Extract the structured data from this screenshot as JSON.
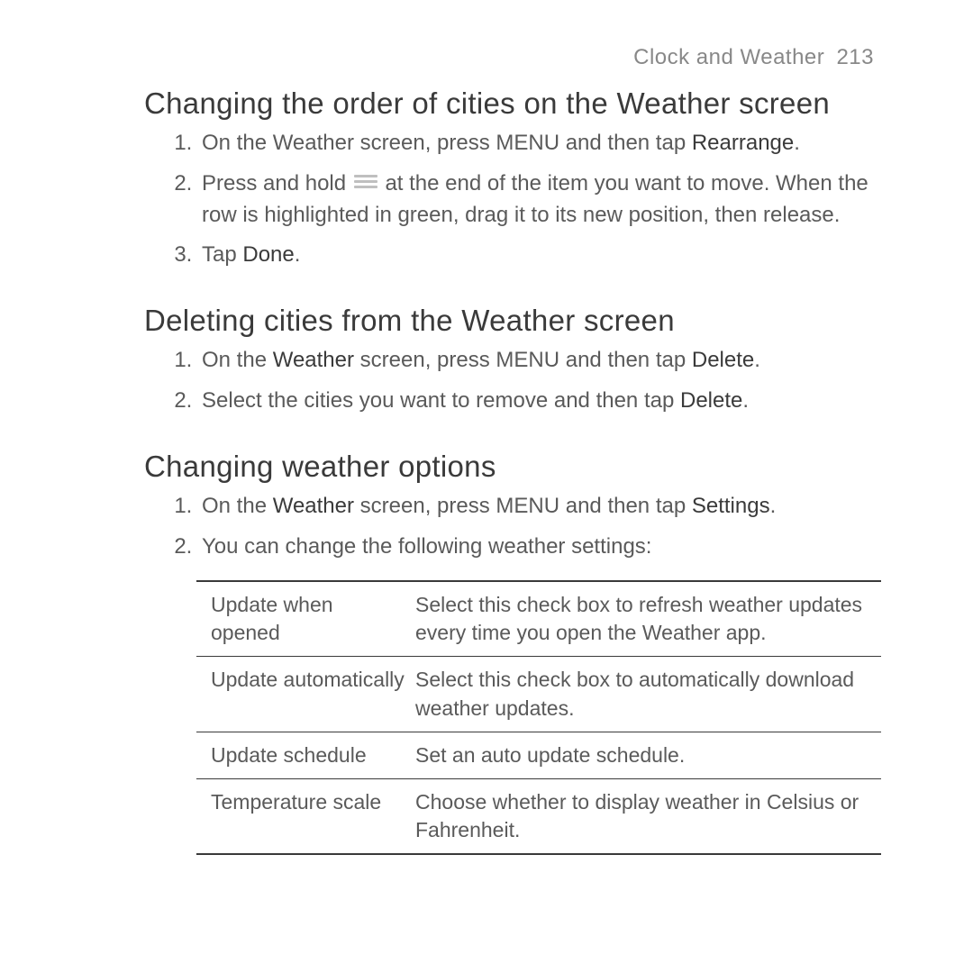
{
  "header": {
    "section": "Clock and Weather",
    "page": "213"
  },
  "sections": [
    {
      "title": "Changing the order of cities on the Weather screen",
      "steps": [
        {
          "pre": "On the Weather screen, press MENU and then tap ",
          "bold": "Rearrange",
          "post": "."
        },
        {
          "pre": "Press and hold ",
          "icon": "grip",
          "post": " at the end of the item you want to move. When the row is highlighted in green, drag it to its new position, then release."
        },
        {
          "pre": "Tap ",
          "bold": "Done",
          "post": "."
        }
      ]
    },
    {
      "title": "Deleting cities from the Weather screen",
      "steps": [
        {
          "pre": "On the ",
          "bold": "Weather",
          "mid": " screen, press MENU and then tap ",
          "bold2": "Delete",
          "post": "."
        },
        {
          "pre": "Select the cities you want to remove and then tap ",
          "bold": "Delete",
          "post": "."
        }
      ]
    },
    {
      "title": "Changing weather options",
      "steps": [
        {
          "pre": "On the ",
          "bold": "Weather",
          "mid": " screen, press MENU and then tap ",
          "bold2": "Settings",
          "post": "."
        },
        {
          "pre": "You can change the following weather settings:"
        }
      ],
      "table": [
        {
          "label": "Update when opened",
          "desc": "Select this check box to refresh weather updates every time you open the Weather app."
        },
        {
          "label": "Update automatically",
          "desc": "Select this check box to automatically download weather updates."
        },
        {
          "label": "Update schedule",
          "desc": "Set an auto update schedule."
        },
        {
          "label": "Temperature scale",
          "desc": "Choose whether to display weather in Celsius or Fahrenheit."
        }
      ]
    }
  ]
}
